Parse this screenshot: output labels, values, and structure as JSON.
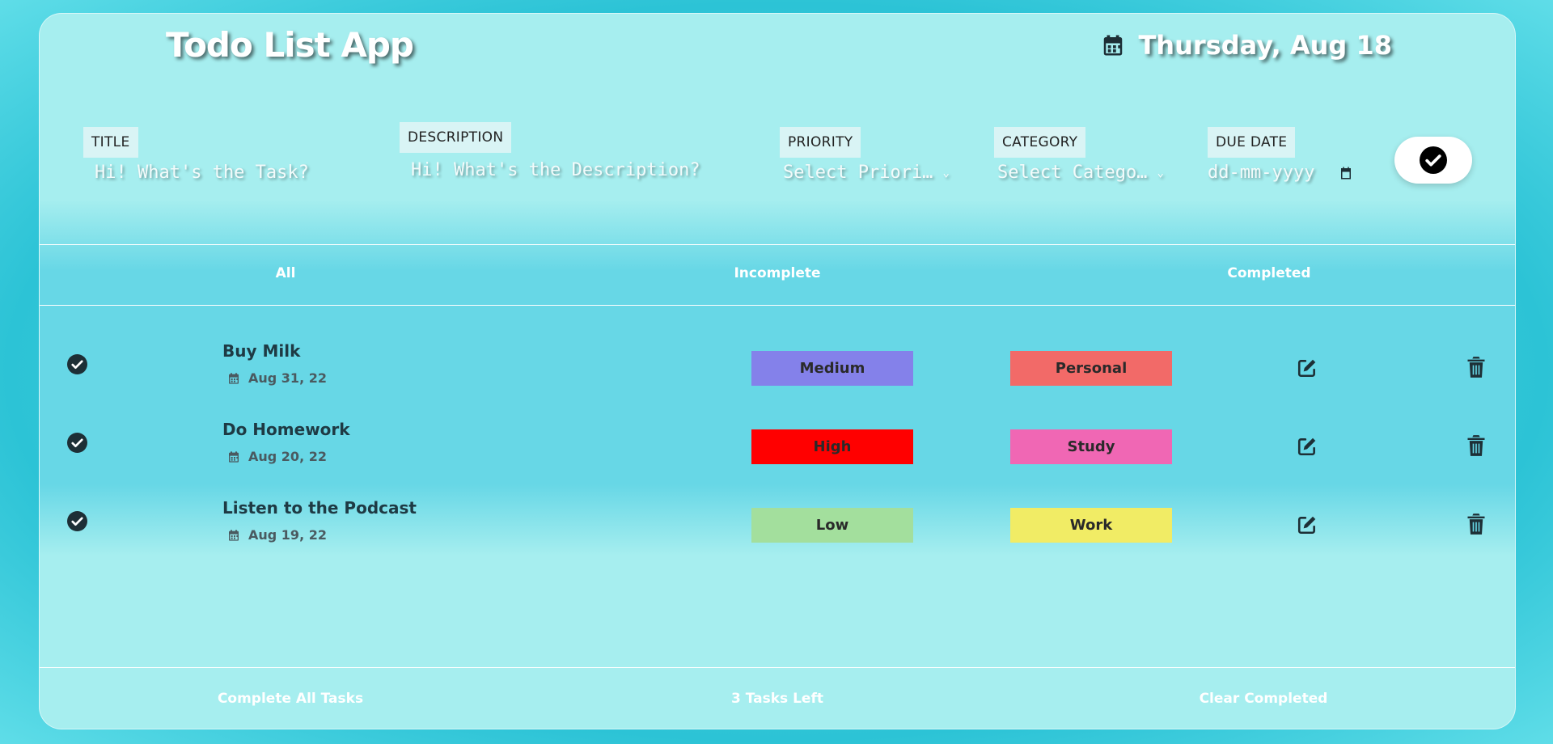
{
  "header": {
    "title": "Todo List App",
    "date": "Thursday, Aug 18"
  },
  "form": {
    "title": {
      "label": "TITLE",
      "placeholder": "Hi! What's the Task?"
    },
    "description": {
      "label": "DESCRIPTION",
      "placeholder": "Hi! What's the Description?"
    },
    "priority": {
      "label": "PRIORITY",
      "selected": "Select Priori…"
    },
    "category": {
      "label": "CATEGORY",
      "selected": "Select Catego…"
    },
    "due": {
      "label": "DUE DATE",
      "placeholder": "dd-mm-yyyy"
    }
  },
  "tabs": [
    "All",
    "Incomplete",
    "Completed"
  ],
  "tasks": [
    {
      "title": "Buy Milk",
      "due": "Aug 31, 22",
      "priority": "Medium",
      "priority_color": "#8481ea",
      "category": "Personal",
      "category_color": "#f26a68"
    },
    {
      "title": "Do Homework",
      "due": "Aug 20, 22",
      "priority": "High",
      "priority_color": "#ff0000",
      "category": "Study",
      "category_color": "#f067b4"
    },
    {
      "title": "Listen to the Podcast",
      "due": "Aug 19, 22",
      "priority": "Low",
      "priority_color": "#a3df9d",
      "category": "Work",
      "category_color": "#f1ec65"
    }
  ],
  "footer": {
    "complete_all": "Complete All Tasks",
    "tasks_left": "3 Tasks Left",
    "clear_completed": "Clear Completed"
  },
  "icons": {
    "calendar": "calendar-icon",
    "check": "check-circle-icon",
    "edit": "edit-icon",
    "delete": "trash-icon"
  }
}
